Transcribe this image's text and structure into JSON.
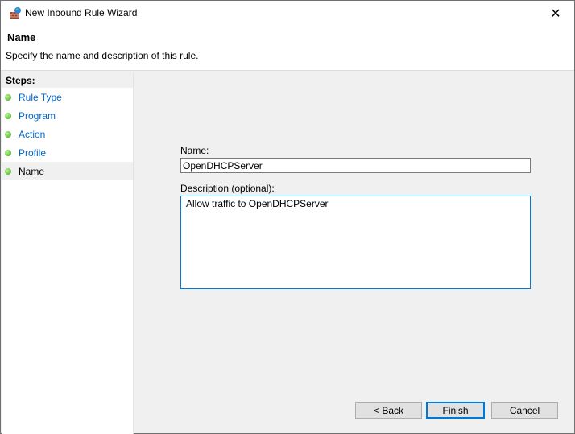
{
  "window": {
    "title": "New Inbound Rule Wizard",
    "close_glyph": "✕"
  },
  "header": {
    "title": "Name",
    "description": "Specify the name and description of this rule."
  },
  "steps": {
    "heading": "Steps:",
    "items": [
      {
        "label": "Rule Type"
      },
      {
        "label": "Program"
      },
      {
        "label": "Action"
      },
      {
        "label": "Profile"
      },
      {
        "label": "Name"
      }
    ]
  },
  "form": {
    "name_label": "Name:",
    "name_value": "OpenDHCPServer",
    "desc_label": "Description (optional):",
    "desc_value": "Allow traffic to OpenDHCPServer"
  },
  "buttons": {
    "back": "< Back",
    "finish": "Finish",
    "cancel": "Cancel"
  }
}
